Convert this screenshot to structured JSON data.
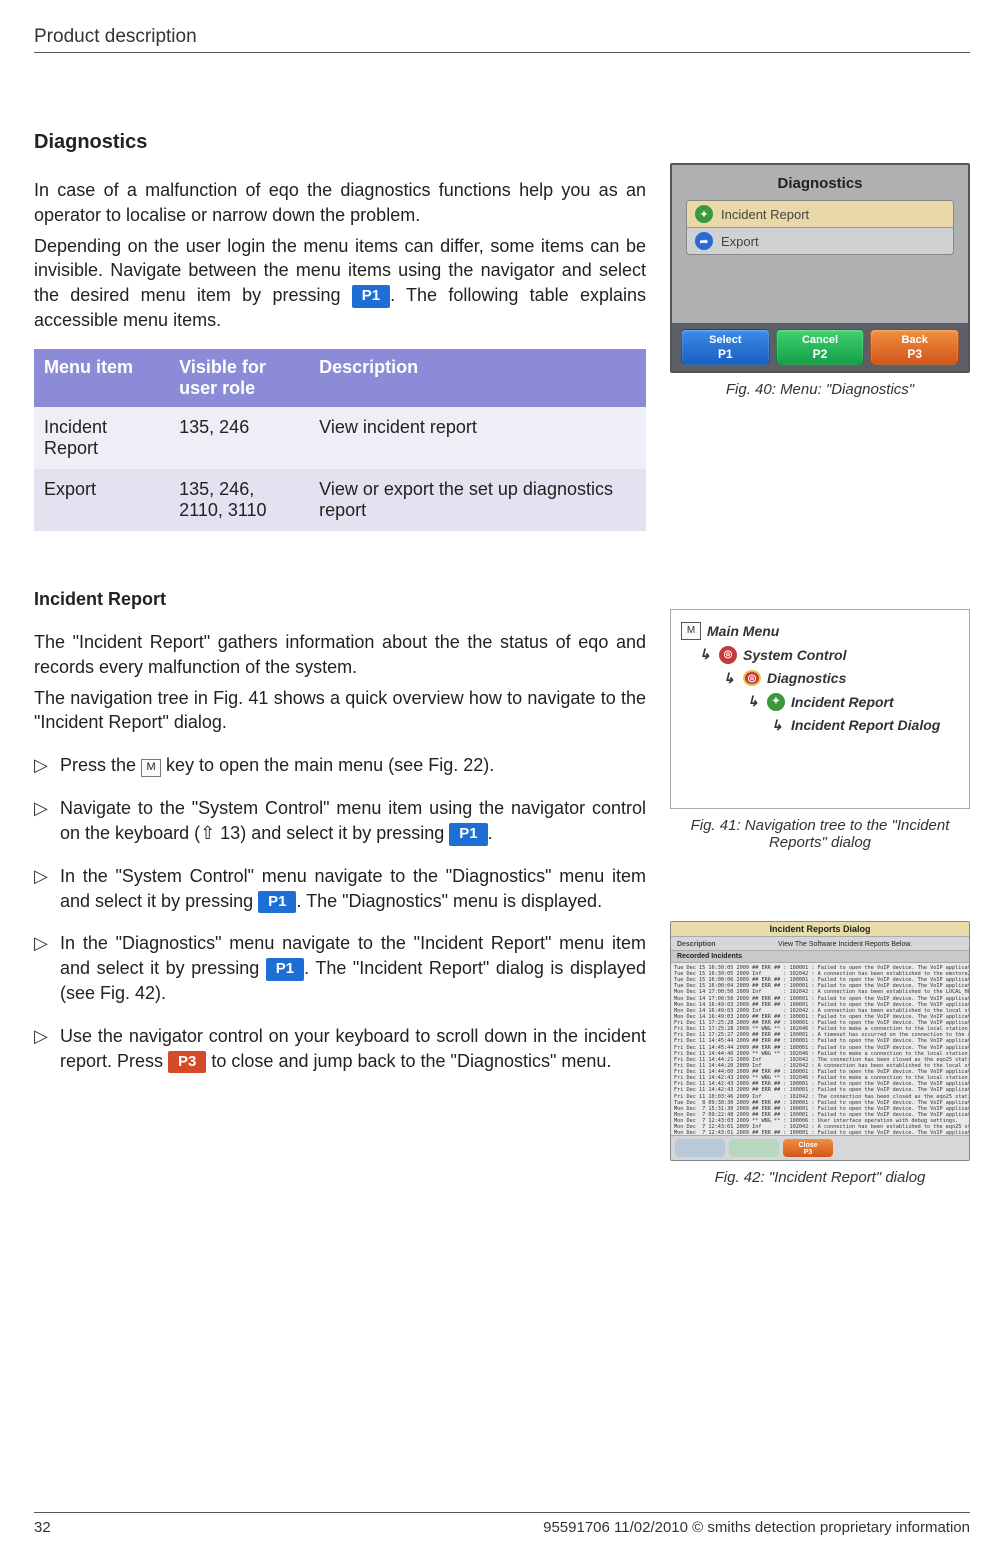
{
  "header": "Product description",
  "sections": {
    "diagnostics_title": "Diagnostics",
    "incident_title": "Incident Report"
  },
  "diagnostics_para1": "In case of a malfunction of eqo the diagnostics functions help you as an operator to localise or narrow down the problem.",
  "diagnostics_para2a": "Depending on the user login the menu items can differ, some items can be invisible. Navigate between the menu items using the navigator and select the desired menu item by pressing ",
  "diagnostics_para2b": ". The following table explains accessible menu items.",
  "keys": {
    "p1": "P1",
    "p3": "P3",
    "m": "M"
  },
  "menu_table": {
    "headers": [
      "Menu item",
      "Visible for user role",
      "Description"
    ],
    "rows": [
      [
        "Incident Report",
        "135, 246",
        "View incident report"
      ],
      [
        "Export",
        "135, 246, 2110, 3110",
        "View or export the set up diagnostics report"
      ]
    ]
  },
  "incident_para1": "The \"Incident Report\" gathers information about the the status of eqo and records every malfunction of the system.",
  "incident_para2": "The navigation tree in Fig. 41 shows a quick overview how to navigate to the \"Incident Report\" dialog.",
  "steps": {
    "s1a": "Press the ",
    "s1b": " key to open the main menu (see Fig. 22).",
    "s2a": "Navigate to the \"System Control\" menu item using the navigator control on the keyboard (⇧ 13) and select it by pressing ",
    "s2b": ".",
    "s3a": "In the \"System Control\" menu navigate to the \"Diagnostics\" menu item and select it by pressing ",
    "s3b": ". The \"Diagnostics\" menu is displayed.",
    "s4a": "In the \"Diagnostics\" menu navigate to the \"Incident Report\" menu item and select it by pressing ",
    "s4b": ". The \"Incident Report\" dialog is displayed (see Fig. 42).",
    "s5a": "Use the navigator control on your keyboard to scroll down in the incident report. Press ",
    "s5b": " to close and jump back to the \"Diagnostics\" menu."
  },
  "fig40": {
    "title": "Diagnostics",
    "items": [
      "Incident Report",
      "Export"
    ],
    "buttons": {
      "select": "Select",
      "select_sub": "P1",
      "cancel": "Cancel",
      "cancel_sub": "P2",
      "back": "Back",
      "back_sub": "P3"
    },
    "caption": "Fig. 40: Menu: \"Diagnostics\""
  },
  "fig41": {
    "items": [
      "Main Menu",
      "System Control",
      "Diagnostics",
      "Incident Report",
      "Incident Report Dialog"
    ],
    "caption": "Fig. 41: Navigation tree to the \"Incident Reports\" dialog"
  },
  "fig42": {
    "title": "Incident Reports Dialog",
    "desc_label": "Description",
    "desc_value": "View The Software Incident Reports Below.",
    "rec_label": "Recorded Incidents",
    "close": "Close",
    "close_sub": "P3",
    "log": "Tue Dec 15 16:30:05 2009 ## ERR ## : 100001 : Failed to open the VoIP device. The VoIP application is not installed at/home/e\nTue Dec 15 16:30:05 2009 Inf       : 102042 : A connection has been established to the emstore22D station.\nTue Dec 15 16:00:06 2009 ## ERR ## : 100001 : Failed to open the VoIP device. The VoIP application is not installed at/home/e\nTue Dec 15 16:00:04 2009 ## ERR ## : 100001 : Failed to open the VoIP device. The VoIP application is not installed at/home/e\nMon Dec 14 17:00:50 2009 Inf       : 102042 : A connection has been established to the LOCAL_HOSTS station.\nMon Dec 14 17:00:50 2009 ## ERR ## : 100001 : Failed to open the VoIP device. The VoIP application is not installed at/home/e\nMon Dec 14 16:49:03 2009 ## ERR ## : 100001 : Failed to open the VoIP device. The VoIP application is not installed at/home/e\nMon Dec 14 16:49:03 2009 Inf       : 102042 : A connection has been established to the local station.\nMon Dec 14 16:49:03 2009 ## ERR ## : 100001 : Failed to open the VoIP device. The VoIP application is not installed at/home/e\nFri Dec 11 17:25:28 2009 ## ERR ## : 100001 : Failed to open the VoIP device. The VoIP application is not installed at/home/e\nFri Dec 11 17:25:28 2009 ** WNG ** : 102046 : Failed to make a connection to the local station.\nFri Dec 11 17:25:27 2009 ## ERR ## : 100001 : A timeout has occurred on the connection to the station local and it has been c\nFri Dec 11 14:45:44 2009 ## ERR ## : 100001 : Failed to open the VoIP device. The VoIP application is not installed at/home/e\nFri Dec 11 14:45:44 2009 ## ERR ## : 100001 : Failed to open the VoIP device. The VoIP application is not installed at/home/e\nFri Dec 11 14:44:40 2009 ** WNG ** : 102046 : Failed to make a connection to the local station.\nFri Dec 11 14:44:21 2009 Inf       : 102042 : The connection has been closed as the eqo25 station has shutdown.\nFri Dec 11 14:44:20 2009 Inf       : 102042 : A connection has been established to the local station.\nFri Dec 11 14:44:00 2009 ## ERR ## : 100001 : Failed to open the VoIP device. The VoIP application is not installed at/home/e\nFri Dec 11 14:42:43 2009 ** WNG ** : 102046 : Failed to make a connection to the local station.\nFri Dec 11 14:42:43 2009 ## ERR ## : 100001 : Failed to open the VoIP device. The VoIP application is not installed at/home/e\nFri Dec 11 14:42:43 2009 ## ERR ## : 100001 : Failed to open the VoIP device. The VoIP application is not installed at/home/e\nFri Dec 11 10:03:46 2009 Inf       : 102042 : The connection has been closed as the eqo25 station has shutdown.\nTue Dec  8 09:30:30 2009 ## ERR ## : 100001 : Failed to open the VoIP device. The VoIP application is not installed at/home/e\nMon Dec  7 15:31:30 2009 ## ERR ## : 100001 : Failed to open the VoIP device. The VoIP application is not installed at/home/e\nMon Dec  7 09:22:48 2009 ## ERR ## : 100001 : Failed to open the VoIP device. The VoIP application is not installed at/home/e\nMon Dec  7 12:43:03 2009 ** WNG ** : 100006 : User interface operation with debug settings.\nMon Dec  7 12:43:01 2009 Inf       : 102042 : A connection has been established to the eqo25 station.\nMon Dec  7 12:43:01 2009 ## ERR ## : 100001 : Failed to open the VoIP device. The VoIP application is not installed at/home/e\nMon Dec  7 12:43:01 2009 ## ERR ## : 100001 : Failed to open the VoIP device. The VoIP application is not installed at/home/e",
    "caption": "Fig. 42: \"Incident Report\" dialog"
  },
  "footer": {
    "page": "32",
    "copyright": "95591706 11/02/2010 © smiths detection proprietary information"
  }
}
